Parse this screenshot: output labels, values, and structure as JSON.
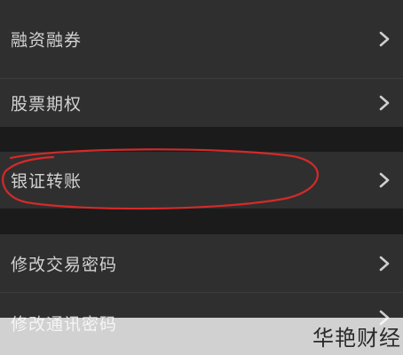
{
  "menu": {
    "items": [
      {
        "label": "融资融券"
      },
      {
        "label": "股票期权"
      },
      {
        "label": "银证转账"
      },
      {
        "label": "修改交易密码"
      },
      {
        "label": "修改通讯密码"
      }
    ],
    "chevron_icon": "chevron-right-icon"
  },
  "annotation": {
    "circle_color": "#d32a2a"
  },
  "watermark": {
    "text": "华艳财经"
  },
  "colors": {
    "background": "#1b1b1b",
    "row": "#2f2f2f",
    "text": "#d2d2d2",
    "chevron": "#cfcfcf"
  }
}
